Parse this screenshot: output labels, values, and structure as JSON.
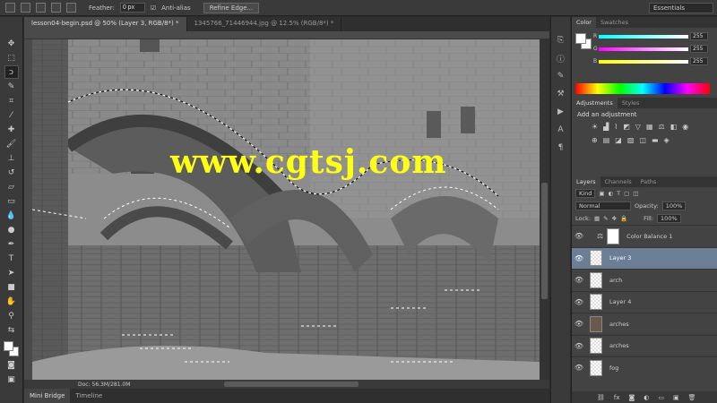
{
  "options_bar": {
    "feather_label": "Feather:",
    "feather_value": "0 px",
    "antialias_label": "Anti-alias",
    "refine_edge_label": "Refine Edge...",
    "workspace": "Essentials"
  },
  "document_tabs": [
    {
      "label": "lesson04-begin.psd @ 50% (Layer 3, RGB/8*) *"
    },
    {
      "label": "1345766_71446944.jpg @ 12.5% (RGB/8*) *"
    }
  ],
  "status": {
    "doc_size": "Doc: 56.3M/281.0M"
  },
  "bottom_tabs": [
    {
      "label": "Mini Bridge"
    },
    {
      "label": "Timeline"
    }
  ],
  "watermark": "www.cgtsj.com",
  "color_panel": {
    "tabs": [
      "Color",
      "Swatches"
    ],
    "sliders": [
      {
        "label": "R",
        "value": "255"
      },
      {
        "label": "G",
        "value": "255"
      },
      {
        "label": "B",
        "value": "255"
      }
    ]
  },
  "adjustments_panel": {
    "tabs": [
      "Adjustments",
      "Styles"
    ],
    "title": "Add an adjustment"
  },
  "layers_panel": {
    "tabs": [
      "Layers",
      "Channels",
      "Paths"
    ],
    "kind_label": "Kind",
    "blend_mode": "Normal",
    "opacity_label": "Opacity:",
    "opacity_value": "100%",
    "lock_label": "Lock:",
    "fill_label": "Fill:",
    "fill_value": "100%",
    "layers": [
      {
        "name": "Color Balance 1",
        "selected": false
      },
      {
        "name": "Layer 3",
        "selected": true
      },
      {
        "name": "arch",
        "selected": false
      },
      {
        "name": "Layer 4",
        "selected": false
      },
      {
        "name": "arches",
        "selected": false
      },
      {
        "name": "arches",
        "selected": false
      },
      {
        "name": "fog",
        "selected": false
      }
    ]
  }
}
